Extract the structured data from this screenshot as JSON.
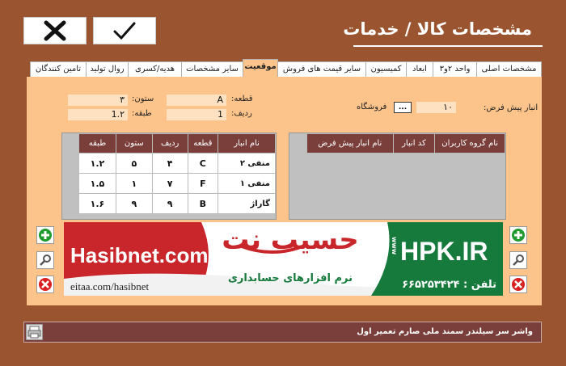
{
  "header": {
    "title": "مشخصات کالا / خدمات"
  },
  "toolbar": {
    "cancel_icon": "x-icon",
    "ok_icon": "check-icon"
  },
  "tabs": [
    {
      "label": "مشخصات اصلی"
    },
    {
      "label": "واحد ۲و۳"
    },
    {
      "label": "ابعاد"
    },
    {
      "label": "کمیسیون"
    },
    {
      "label": "سایر قیمت های فروش"
    },
    {
      "label": "موقعیت",
      "active": true
    },
    {
      "label": "سایر مشخصات"
    },
    {
      "label": "هدیه/کسری"
    },
    {
      "label": "روال تولید"
    },
    {
      "label": "تامین کنندگان"
    }
  ],
  "location": {
    "section_label": "قطعه:",
    "section_value": "A",
    "row_label": "ردیف:",
    "row_value": "1",
    "column_label": "ستون:",
    "column_value": "۳",
    "shelf_label": "طبقه:",
    "shelf_value": "1.۲"
  },
  "default_warehouse": {
    "label": "انبار پیش فرض:",
    "value": "۱۰",
    "lookup_button": "...",
    "store_label": "فروشگاه"
  },
  "warehouse_table": {
    "columns": [
      "نام انبار",
      "قطعه",
      "ردیف",
      "ستون",
      "طبقه"
    ],
    "rows": [
      [
        "منفی ۲",
        "C",
        "۴",
        "۵",
        "۱.۲"
      ],
      [
        "منفی ۱",
        "F",
        "۷",
        "۱",
        "۱.۵"
      ],
      [
        "گاراژ",
        "B",
        "۹",
        "۹",
        "۱.۶"
      ]
    ]
  },
  "user_group_table": {
    "columns": [
      "نام گروه کاربران",
      "کد انبار",
      "نام انبار پیش فرض"
    ],
    "rows": []
  },
  "banner": {
    "left_brand": "Hasibnet.com",
    "left_url": "eitaa.com/hasibnet",
    "center_brand": "حسیب نت",
    "center_tagline": "نرم افزارهای حسابداری",
    "right_brand": "HPK.IR",
    "right_prefix": "www",
    "phone_label": "تلفن :",
    "phone_number": "۶۶۵۲۵۳۴۲۴"
  },
  "status": {
    "text": "واشر سر سیلندر سمند ملی صارم تعمیر اول"
  },
  "colors": {
    "background": "#9a5530",
    "panel": "#fcc48a",
    "header_cell": "#7a3f3a",
    "banner_red": "#c9262b",
    "banner_green": "#167a3c"
  }
}
